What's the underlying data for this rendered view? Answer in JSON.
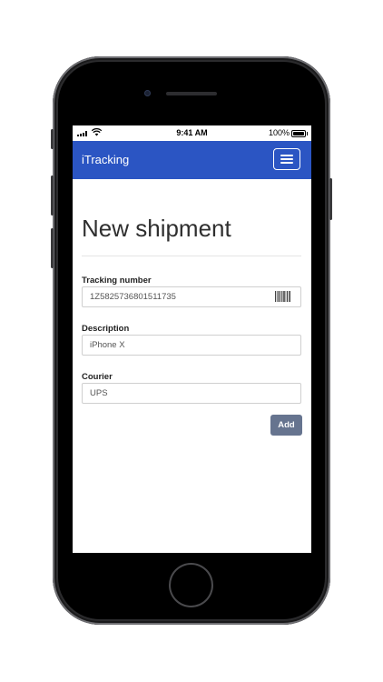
{
  "status_bar": {
    "time": "9:41 AM",
    "battery": "100%"
  },
  "navbar": {
    "brand": "iTracking",
    "menu_icon": "hamburger-menu-icon"
  },
  "page": {
    "title": "New shipment"
  },
  "form": {
    "tracking": {
      "label": "Tracking number",
      "value": "1Z5825736801511735",
      "icon": "barcode-icon"
    },
    "description": {
      "label": "Description",
      "value": "iPhone X"
    },
    "courier": {
      "label": "Courier",
      "value": "UPS"
    },
    "submit_label": "Add"
  },
  "colors": {
    "navbar": "#2b55c3",
    "button": "#66748f"
  }
}
